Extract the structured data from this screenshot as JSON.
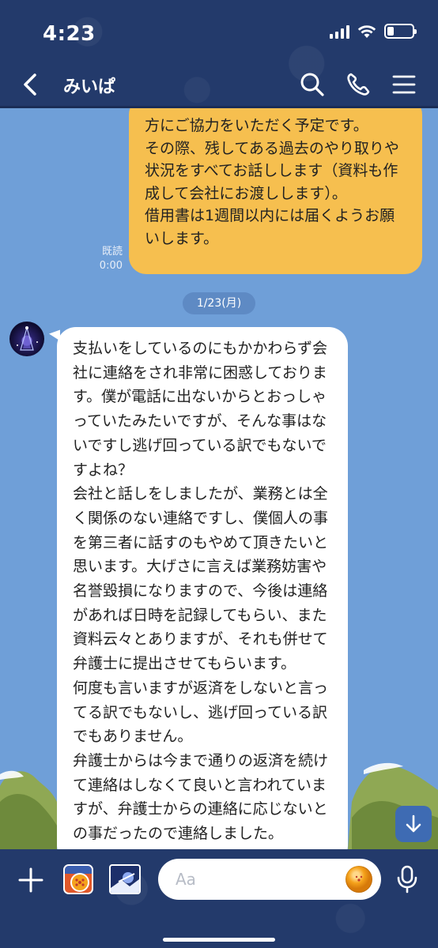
{
  "status_bar": {
    "time": "4:23",
    "battery_level": 0.25
  },
  "header": {
    "title": "みいぱ",
    "icons": [
      "back-chevron-icon",
      "search-icon",
      "phone-icon",
      "menu-icon"
    ]
  },
  "messages": [
    {
      "direction": "outgoing",
      "text": "方にご協力をいただく予定です。\nその際、残してある過去のやり取りや状況をすべてお話しします（資料も作成して会社にお渡しします）。\n借用書は1週間以内には届くようお願いします。",
      "read_label": "既読",
      "time": "0:00"
    },
    {
      "direction": "incoming",
      "text": "支払いをしているのにもかかわらず会社に連絡をされ非常に困惑しております。僕が電話に出ないからとおっしゃっていたみたいですが、そんな事はないですし逃げ回っている訳でもないですよね？\n会社と話しをしましたが、業務とは全く関係のない連絡ですし、僕個人の事を第三者に話すのもやめて頂きたいと思います。大げさに言えば業務妨害や名誉毀損になりますので、今後は連絡があれば日時を記録してもらい、また資料云々とありますが、それも併せて弁護士に提出させてもらいます。\n何度も言いますが返済をしないと言ってる訳でもないし、逃げ回っている訳でもありません。\n弁護士からは今まで通りの返済を続けて連絡はしなくて良いと言われていますが、弁護士からの連絡に応じないとの事だったので連絡しました。"
    }
  ],
  "date_separator": "1/23(月)",
  "input": {
    "placeholder": "Aa",
    "value": ""
  },
  "colors": {
    "header_bg": "#233a6b",
    "chat_bg": "#6f9fd8",
    "outgoing_bubble": "#f6bf4f",
    "incoming_bubble": "#ffffff",
    "scroll_button": "#3e6bb3"
  }
}
